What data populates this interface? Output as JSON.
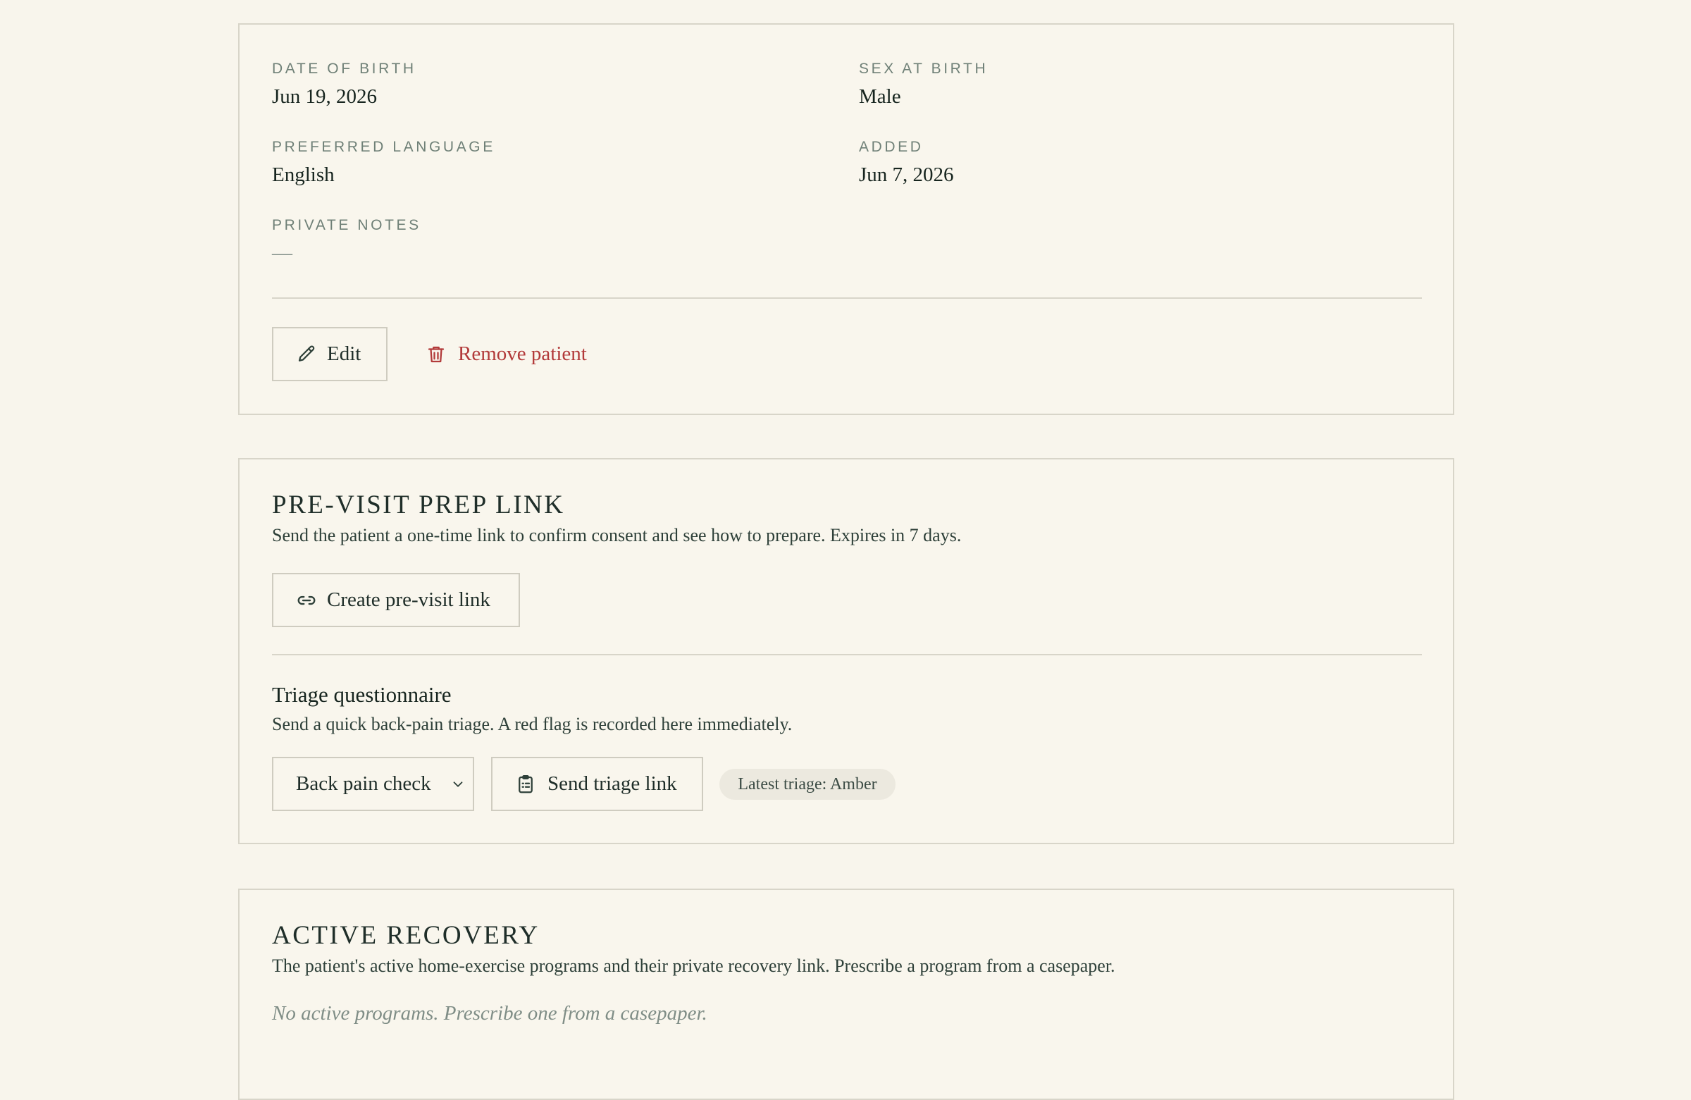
{
  "details": {
    "date_of_birth_label": "DATE OF BIRTH",
    "date_of_birth": "Jun 19, 2026",
    "sex_label": "SEX AT BIRTH",
    "sex": "Male",
    "language_label": "PREFERRED LANGUAGE",
    "language": "English",
    "added_label": "ADDED",
    "added": "Jun 7, 2026",
    "notes_label": "PRIVATE NOTES",
    "notes": "—",
    "edit_label": "Edit",
    "remove_label": "Remove patient"
  },
  "previsit": {
    "title": "PRE-VISIT PREP LINK",
    "description": "Send the patient a one-time link to confirm consent and see how to prepare. Expires in 7 days.",
    "create_label": "Create pre-visit link",
    "triage_title": "Triage questionnaire",
    "triage_description": "Send a quick back-pain triage. A red flag is recorded here immediately.",
    "triage_select_value": "Back pain check",
    "send_label": "Send triage link",
    "latest_badge": "Latest triage: Amber"
  },
  "recovery": {
    "title": "ACTIVE RECOVERY",
    "description": "The patient's active home-exercise programs and their private recovery link. Prescribe a program from a casepaper.",
    "empty_note": "No active programs. Prescribe one from a casepaper."
  },
  "colors": {
    "background": "#f8f5ec",
    "border": "#d8d5c9",
    "text": "#1f2e29",
    "label": "#6f8077",
    "danger": "#b23a3a",
    "badge_bg": "#ece9df"
  },
  "icons": {
    "edit": "pencil-icon",
    "remove": "trash-icon",
    "create": "link-icon",
    "select": "chevron-down-icon",
    "send": "clipboard-icon"
  }
}
